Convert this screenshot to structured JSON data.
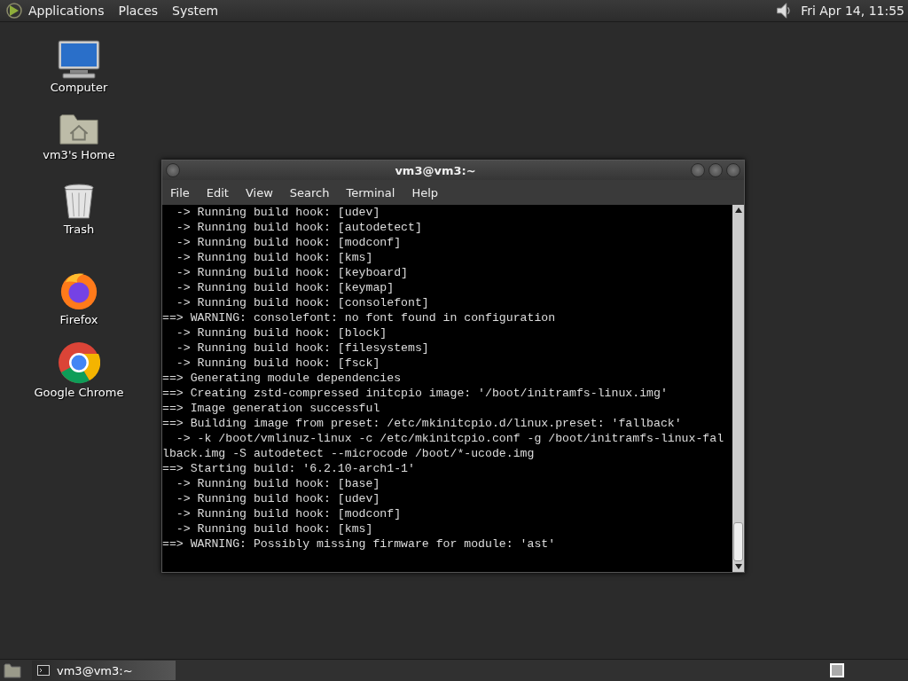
{
  "top_panel": {
    "menus": [
      "Applications",
      "Places",
      "System"
    ],
    "clock": "Fri Apr 14, 11:55"
  },
  "desktop_icons": [
    {
      "label": "Computer",
      "kind": "computer"
    },
    {
      "label": "vm3's Home",
      "kind": "home"
    },
    {
      "label": "Trash",
      "kind": "trash"
    },
    {
      "label": "Firefox",
      "kind": "firefox"
    },
    {
      "label": "Google Chrome",
      "kind": "chrome"
    }
  ],
  "terminal": {
    "title": "vm3@vm3:~",
    "menus": [
      "File",
      "Edit",
      "View",
      "Search",
      "Terminal",
      "Help"
    ],
    "lines": [
      "  -> Running build hook: [udev]",
      "  -> Running build hook: [autodetect]",
      "  -> Running build hook: [modconf]",
      "  -> Running build hook: [kms]",
      "  -> Running build hook: [keyboard]",
      "  -> Running build hook: [keymap]",
      "  -> Running build hook: [consolefont]",
      "==> WARNING: consolefont: no font found in configuration",
      "  -> Running build hook: [block]",
      "  -> Running build hook: [filesystems]",
      "  -> Running build hook: [fsck]",
      "==> Generating module dependencies",
      "==> Creating zstd-compressed initcpio image: '/boot/initramfs-linux.img'",
      "==> Image generation successful",
      "==> Building image from preset: /etc/mkinitcpio.d/linux.preset: 'fallback'",
      "  -> -k /boot/vmlinuz-linux -c /etc/mkinitcpio.conf -g /boot/initramfs-linux-fal",
      "lback.img -S autodetect --microcode /boot/*-ucode.img",
      "==> Starting build: '6.2.10-arch1-1'",
      "  -> Running build hook: [base]",
      "  -> Running build hook: [udev]",
      "  -> Running build hook: [modconf]",
      "  -> Running build hook: [kms]",
      "==> WARNING: Possibly missing firmware for module: 'ast'"
    ]
  },
  "taskbar": {
    "tasks": [
      {
        "label": "vm3@vm3:~",
        "selected": true
      }
    ]
  }
}
